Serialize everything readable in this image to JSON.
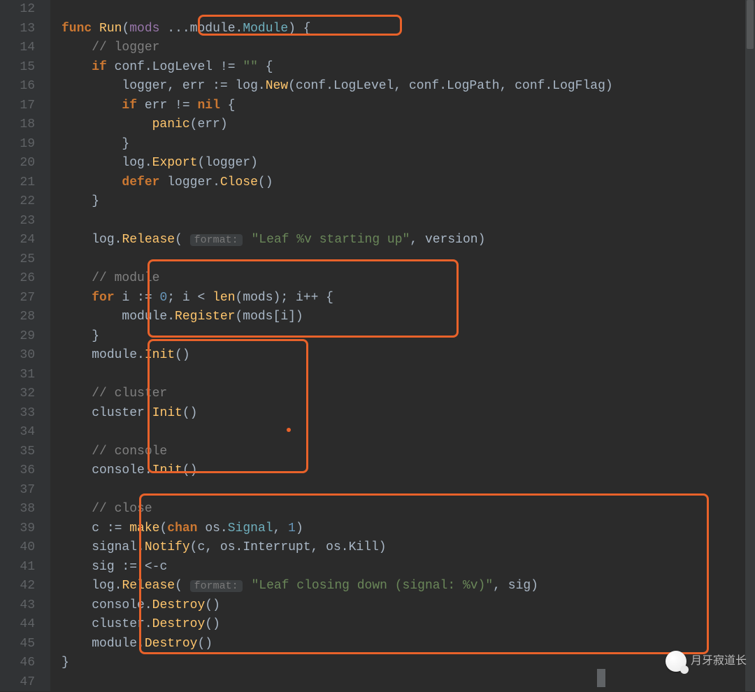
{
  "gutter": {
    "start": 12,
    "end": 47
  },
  "hints": {
    "format": "format:"
  },
  "watermark": "月牙寂道长",
  "lines": [
    [],
    [
      {
        "t": "kw",
        "v": "func"
      },
      {
        "t": "op",
        "v": " "
      },
      {
        "t": "fn",
        "v": "Run"
      },
      {
        "t": "punct",
        "v": "("
      },
      {
        "t": "param",
        "v": "mods"
      },
      {
        "t": "op",
        "v": " ..."
      },
      {
        "t": "ident",
        "v": "module"
      },
      {
        "t": "punct",
        "v": "."
      },
      {
        "t": "type",
        "v": "Module"
      },
      {
        "t": "punct",
        "v": ") {"
      }
    ],
    [
      {
        "t": "pad",
        "v": "    "
      },
      {
        "t": "cmt",
        "v": "// logger"
      }
    ],
    [
      {
        "t": "pad",
        "v": "    "
      },
      {
        "t": "kw",
        "v": "if"
      },
      {
        "t": "op",
        "v": " "
      },
      {
        "t": "ident",
        "v": "conf"
      },
      {
        "t": "punct",
        "v": "."
      },
      {
        "t": "ident",
        "v": "LogLevel"
      },
      {
        "t": "op",
        "v": " != "
      },
      {
        "t": "str",
        "v": "\"\""
      },
      {
        "t": "op",
        "v": " {"
      }
    ],
    [
      {
        "t": "pad",
        "v": "        "
      },
      {
        "t": "ident",
        "v": "logger"
      },
      {
        "t": "punct",
        "v": ", "
      },
      {
        "t": "ident",
        "v": "err"
      },
      {
        "t": "op",
        "v": " := "
      },
      {
        "t": "ident",
        "v": "log"
      },
      {
        "t": "punct",
        "v": "."
      },
      {
        "t": "fn",
        "v": "New"
      },
      {
        "t": "punct",
        "v": "("
      },
      {
        "t": "ident",
        "v": "conf"
      },
      {
        "t": "punct",
        "v": "."
      },
      {
        "t": "ident",
        "v": "LogLevel"
      },
      {
        "t": "punct",
        "v": ", "
      },
      {
        "t": "ident",
        "v": "conf"
      },
      {
        "t": "punct",
        "v": "."
      },
      {
        "t": "ident",
        "v": "LogPath"
      },
      {
        "t": "punct",
        "v": ", "
      },
      {
        "t": "ident",
        "v": "conf"
      },
      {
        "t": "punct",
        "v": "."
      },
      {
        "t": "ident",
        "v": "LogFlag"
      },
      {
        "t": "punct",
        "v": ")"
      }
    ],
    [
      {
        "t": "pad",
        "v": "        "
      },
      {
        "t": "kw",
        "v": "if"
      },
      {
        "t": "op",
        "v": " "
      },
      {
        "t": "ident",
        "v": "err"
      },
      {
        "t": "op",
        "v": " != "
      },
      {
        "t": "kw",
        "v": "nil"
      },
      {
        "t": "op",
        "v": " {"
      }
    ],
    [
      {
        "t": "pad",
        "v": "            "
      },
      {
        "t": "fn",
        "v": "panic"
      },
      {
        "t": "punct",
        "v": "("
      },
      {
        "t": "ident",
        "v": "err"
      },
      {
        "t": "punct",
        "v": ")"
      }
    ],
    [
      {
        "t": "pad",
        "v": "        "
      },
      {
        "t": "punct",
        "v": "}"
      }
    ],
    [
      {
        "t": "pad",
        "v": "        "
      },
      {
        "t": "ident",
        "v": "log"
      },
      {
        "t": "punct",
        "v": "."
      },
      {
        "t": "fn",
        "v": "Export"
      },
      {
        "t": "punct",
        "v": "("
      },
      {
        "t": "ident",
        "v": "logger"
      },
      {
        "t": "punct",
        "v": ")"
      }
    ],
    [
      {
        "t": "pad",
        "v": "        "
      },
      {
        "t": "kw",
        "v": "defer"
      },
      {
        "t": "op",
        "v": " "
      },
      {
        "t": "ident",
        "v": "logger"
      },
      {
        "t": "punct",
        "v": "."
      },
      {
        "t": "fn",
        "v": "Close"
      },
      {
        "t": "punct",
        "v": "()"
      }
    ],
    [
      {
        "t": "pad",
        "v": "    "
      },
      {
        "t": "punct",
        "v": "}"
      }
    ],
    [],
    [
      {
        "t": "pad",
        "v": "    "
      },
      {
        "t": "ident",
        "v": "log"
      },
      {
        "t": "punct",
        "v": "."
      },
      {
        "t": "fn",
        "v": "Release"
      },
      {
        "t": "punct",
        "v": "( "
      },
      {
        "t": "hint",
        "k": "format"
      },
      {
        "t": "op",
        "v": " "
      },
      {
        "t": "str",
        "v": "\"Leaf %v starting up\""
      },
      {
        "t": "punct",
        "v": ", "
      },
      {
        "t": "ident",
        "v": "version"
      },
      {
        "t": "punct",
        "v": ")"
      }
    ],
    [],
    [
      {
        "t": "pad",
        "v": "    "
      },
      {
        "t": "cmt",
        "v": "// module"
      }
    ],
    [
      {
        "t": "pad",
        "v": "    "
      },
      {
        "t": "kw",
        "v": "for"
      },
      {
        "t": "op",
        "v": " "
      },
      {
        "t": "ident",
        "v": "i"
      },
      {
        "t": "op",
        "v": " := "
      },
      {
        "t": "num",
        "v": "0"
      },
      {
        "t": "punct",
        "v": "; "
      },
      {
        "t": "ident",
        "v": "i"
      },
      {
        "t": "op",
        "v": " < "
      },
      {
        "t": "fn",
        "v": "len"
      },
      {
        "t": "punct",
        "v": "("
      },
      {
        "t": "ident",
        "v": "mods"
      },
      {
        "t": "punct",
        "v": "); "
      },
      {
        "t": "ident",
        "v": "i"
      },
      {
        "t": "op",
        "v": "++ {"
      }
    ],
    [
      {
        "t": "pad",
        "v": "        "
      },
      {
        "t": "ident",
        "v": "module"
      },
      {
        "t": "punct",
        "v": "."
      },
      {
        "t": "fn",
        "v": "Register"
      },
      {
        "t": "punct",
        "v": "("
      },
      {
        "t": "ident",
        "v": "mods"
      },
      {
        "t": "punct",
        "v": "["
      },
      {
        "t": "ident",
        "v": "i"
      },
      {
        "t": "punct",
        "v": "])"
      }
    ],
    [
      {
        "t": "pad",
        "v": "    "
      },
      {
        "t": "punct",
        "v": "}"
      }
    ],
    [
      {
        "t": "pad",
        "v": "    "
      },
      {
        "t": "ident",
        "v": "module"
      },
      {
        "t": "punct",
        "v": "."
      },
      {
        "t": "fn",
        "v": "Init"
      },
      {
        "t": "punct",
        "v": "()"
      }
    ],
    [],
    [
      {
        "t": "pad",
        "v": "    "
      },
      {
        "t": "cmt",
        "v": "// cluster"
      }
    ],
    [
      {
        "t": "pad",
        "v": "    "
      },
      {
        "t": "ident",
        "v": "cluster"
      },
      {
        "t": "punct",
        "v": "."
      },
      {
        "t": "fn",
        "v": "Init"
      },
      {
        "t": "punct",
        "v": "()"
      }
    ],
    [],
    [
      {
        "t": "pad",
        "v": "    "
      },
      {
        "t": "cmt",
        "v": "// console"
      }
    ],
    [
      {
        "t": "pad",
        "v": "    "
      },
      {
        "t": "ident",
        "v": "console"
      },
      {
        "t": "punct",
        "v": "."
      },
      {
        "t": "fn",
        "v": "Init"
      },
      {
        "t": "punct",
        "v": "()"
      }
    ],
    [],
    [
      {
        "t": "pad",
        "v": "    "
      },
      {
        "t": "cmt",
        "v": "// close"
      }
    ],
    [
      {
        "t": "pad",
        "v": "    "
      },
      {
        "t": "ident",
        "v": "c"
      },
      {
        "t": "op",
        "v": " := "
      },
      {
        "t": "fn",
        "v": "make"
      },
      {
        "t": "punct",
        "v": "("
      },
      {
        "t": "kw",
        "v": "chan"
      },
      {
        "t": "op",
        "v": " "
      },
      {
        "t": "ident",
        "v": "os"
      },
      {
        "t": "punct",
        "v": "."
      },
      {
        "t": "type",
        "v": "Signal"
      },
      {
        "t": "punct",
        "v": ", "
      },
      {
        "t": "num",
        "v": "1"
      },
      {
        "t": "punct",
        "v": ")"
      }
    ],
    [
      {
        "t": "pad",
        "v": "    "
      },
      {
        "t": "ident",
        "v": "signal"
      },
      {
        "t": "punct",
        "v": "."
      },
      {
        "t": "fn",
        "v": "Notify"
      },
      {
        "t": "punct",
        "v": "("
      },
      {
        "t": "ident",
        "v": "c"
      },
      {
        "t": "punct",
        "v": ", "
      },
      {
        "t": "ident",
        "v": "os"
      },
      {
        "t": "punct",
        "v": "."
      },
      {
        "t": "ident",
        "v": "Interrupt"
      },
      {
        "t": "punct",
        "v": ", "
      },
      {
        "t": "ident",
        "v": "os"
      },
      {
        "t": "punct",
        "v": "."
      },
      {
        "t": "ident",
        "v": "Kill"
      },
      {
        "t": "punct",
        "v": ")"
      }
    ],
    [
      {
        "t": "pad",
        "v": "    "
      },
      {
        "t": "ident",
        "v": "sig"
      },
      {
        "t": "op",
        "v": " := <-"
      },
      {
        "t": "ident",
        "v": "c"
      }
    ],
    [
      {
        "t": "pad",
        "v": "    "
      },
      {
        "t": "ident",
        "v": "log"
      },
      {
        "t": "punct",
        "v": "."
      },
      {
        "t": "fn",
        "v": "Release"
      },
      {
        "t": "punct",
        "v": "( "
      },
      {
        "t": "hint",
        "k": "format"
      },
      {
        "t": "op",
        "v": " "
      },
      {
        "t": "str",
        "v": "\"Leaf closing down (signal: %v)\""
      },
      {
        "t": "punct",
        "v": ", "
      },
      {
        "t": "ident",
        "v": "sig"
      },
      {
        "t": "punct",
        "v": ")"
      }
    ],
    [
      {
        "t": "pad",
        "v": "    "
      },
      {
        "t": "ident",
        "v": "console"
      },
      {
        "t": "punct",
        "v": "."
      },
      {
        "t": "fn",
        "v": "Destroy"
      },
      {
        "t": "punct",
        "v": "()"
      }
    ],
    [
      {
        "t": "pad",
        "v": "    "
      },
      {
        "t": "ident",
        "v": "cluster"
      },
      {
        "t": "punct",
        "v": "."
      },
      {
        "t": "fn",
        "v": "Destroy"
      },
      {
        "t": "punct",
        "v": "()"
      }
    ],
    [
      {
        "t": "pad",
        "v": "    "
      },
      {
        "t": "ident",
        "v": "module"
      },
      {
        "t": "punct",
        "v": "."
      },
      {
        "t": "fn",
        "v": "Destroy"
      },
      {
        "t": "punct",
        "v": "()"
      }
    ],
    [
      {
        "t": "punct",
        "v": "}"
      }
    ],
    []
  ]
}
